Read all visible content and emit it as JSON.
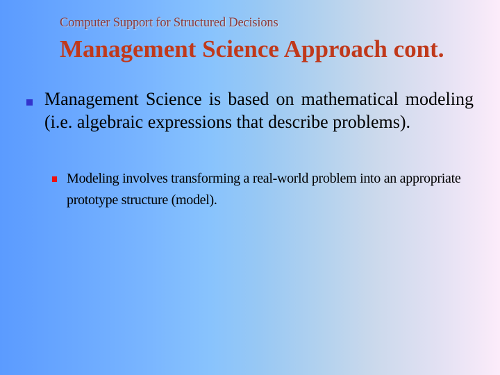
{
  "slide": {
    "header": "Computer Support for Structured Decisions",
    "title": "Management Science Approach cont.",
    "bullets": [
      {
        "level": 1,
        "text": "Management Science is based on mathematical modeling (i.e. algebraic expressions that describe problems).",
        "bullet_color": "#3333cc",
        "bullet_icon": "square-bullet-icon"
      },
      {
        "level": 2,
        "text": "Modeling involves transforming a real-world problem into an appropriate prototype structure (model).",
        "bullet_color": "#ee1111",
        "bullet_icon": "square-bullet-icon"
      }
    ],
    "colors": {
      "header_text": "#8b3a3a",
      "title_text": "#c0391b",
      "body_text": "#000000",
      "background_left": "#5b9bff",
      "background_mid": "#88c3fd",
      "background_right": "#fcecfa"
    }
  }
}
